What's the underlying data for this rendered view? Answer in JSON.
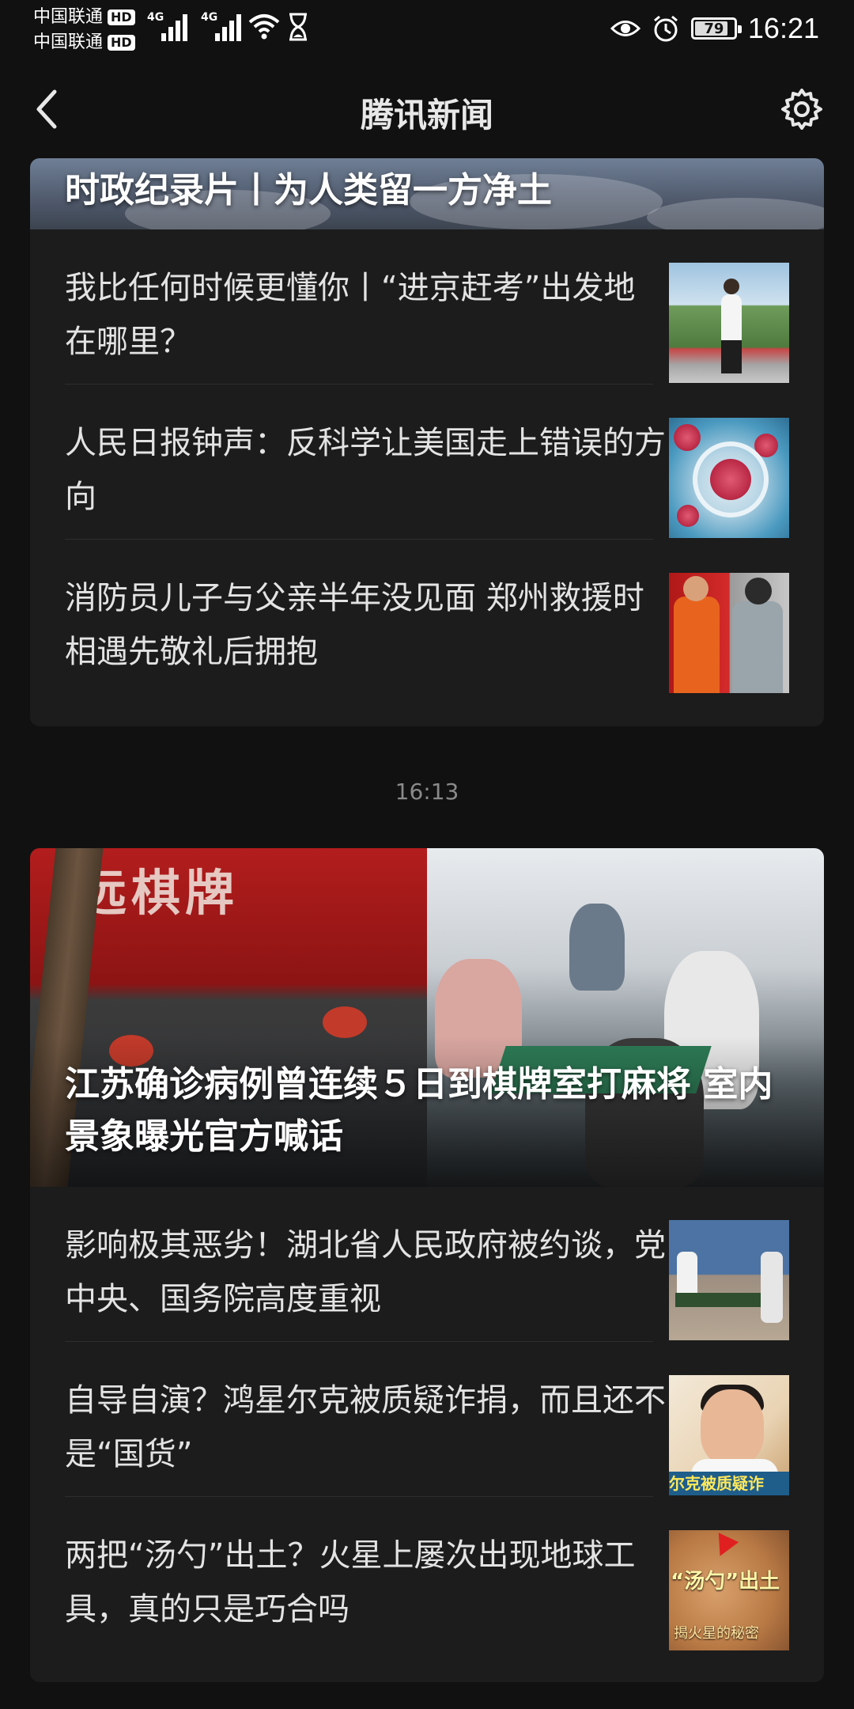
{
  "status_bar": {
    "carrier_1": "中国联通",
    "carrier_2": "中国联通",
    "hd_badge": "HD",
    "network_1": "4G",
    "network_2": "4G",
    "battery_percent": "79",
    "battery_level": 0.79,
    "time": "16:21",
    "icons": [
      "signal-icon",
      "wifi-icon",
      "hourglass-icon",
      "eye-icon",
      "alarm-icon",
      "battery-icon"
    ]
  },
  "header": {
    "title": "腾讯新闻",
    "back_icon": "chevron-left-icon",
    "settings_icon": "gear-icon"
  },
  "card_1": {
    "hero_title": "时政纪录片丨为人类留一方净土",
    "items": [
      {
        "title": "我比任何时候更懂你丨“进京赶考”出发地在哪里？",
        "thumb": "photo-outdoor"
      },
      {
        "title": "人民日报钟声：反科学让美国走上错误的方向",
        "thumb": "photo-virus"
      },
      {
        "title": "消防员儿子与父亲半年没见面 郑州救援时相遇先敬礼后拥抱",
        "thumb": "photo-firefighter"
      }
    ]
  },
  "timestamp": "16:13",
  "card_2": {
    "hero_title": "江苏确诊病例曾连续５日到棋牌室打麻将 室内景象曝光官方喊话",
    "hero_sign_text": "远棋牌",
    "items": [
      {
        "title": "影响极其恶劣！湖北省人民政府被约谈，党中央、国务院高度重视",
        "thumb": "photo-rescue"
      },
      {
        "title": "自导自演？鸿星尔克被质疑诈捐，而且还不是“国货”",
        "thumb": "photo-hongxing",
        "thumb_caption": "尔克被质疑诈"
      },
      {
        "title": "两把“汤勺”出土？火星上屡次出现地球工具，真的只是巧合吗",
        "thumb": "photo-mars",
        "thumb_caption": "“汤勺”出土",
        "thumb_subcaption": "揭火星的秘密"
      }
    ]
  },
  "colors": {
    "background": "#111111",
    "card": "#1c1c1c",
    "text": "#e3e3e3",
    "muted": "#8a8a8a"
  }
}
